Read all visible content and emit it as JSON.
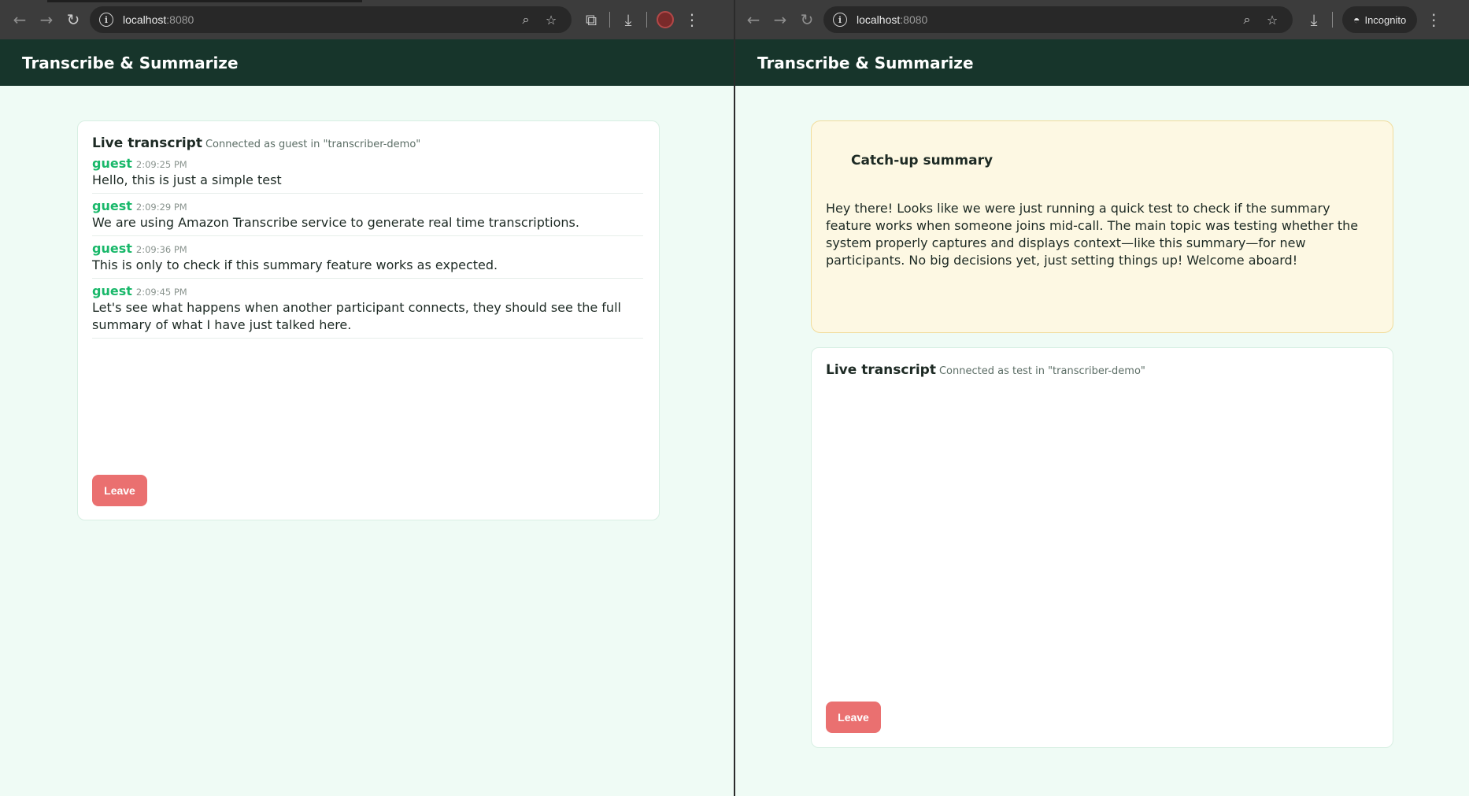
{
  "left": {
    "toolbar": {
      "url_host": "localhost",
      "url_port": ":8080",
      "icons": [
        "back-arrow-icon",
        "forward-arrow-icon",
        "reload-icon",
        "info-icon",
        "zoom-icon",
        "star-icon",
        "extensions-icon",
        "download-icon",
        "profile-avatar-icon",
        "kebab-menu-icon"
      ]
    },
    "app_title": "Transcribe & Summarize",
    "transcript": {
      "title": "Live transcript",
      "status": "Connected as guest in \"transcriber-demo\"",
      "entries": [
        {
          "speaker": "guest",
          "time": "2:09:25 PM",
          "text": "Hello, this is just a simple test"
        },
        {
          "speaker": "guest",
          "time": "2:09:29 PM",
          "text": "We are using Amazon Transcribe service to generate real time transcriptions."
        },
        {
          "speaker": "guest",
          "time": "2:09:36 PM",
          "text": "This is only to check if this summary feature works as expected."
        },
        {
          "speaker": "guest",
          "time": "2:09:45 PM",
          "text": "Let's see what happens when another participant connects, they should see the full summary of what I have just talked here."
        }
      ],
      "leave_label": "Leave"
    }
  },
  "right": {
    "toolbar": {
      "url_host": "localhost",
      "url_port": ":8080",
      "incognito_label": "Incognito",
      "icons": [
        "back-arrow-icon",
        "forward-arrow-icon",
        "reload-icon",
        "info-icon",
        "zoom-icon",
        "star-icon",
        "download-icon",
        "incognito-icon",
        "kebab-menu-icon"
      ]
    },
    "app_title": "Transcribe & Summarize",
    "summary": {
      "title": "Catch-up summary",
      "body": "Hey there! Looks like we were just running a quick test to check if the summary feature works when someone joins mid-call. The main topic was testing whether the system properly captures and displays context—like this summary—for new participants. No big decisions yet, just setting things up! Welcome aboard!"
    },
    "transcript": {
      "title": "Live transcript",
      "status": "Connected as test in \"transcriber-demo\"",
      "leave_label": "Leave"
    }
  },
  "colors": {
    "header_bg": "#17352b",
    "page_bg": "#effbf5",
    "speaker": "#19b86a",
    "leave_button": "#ea7070",
    "summary_bg": "#fdf8e3"
  }
}
